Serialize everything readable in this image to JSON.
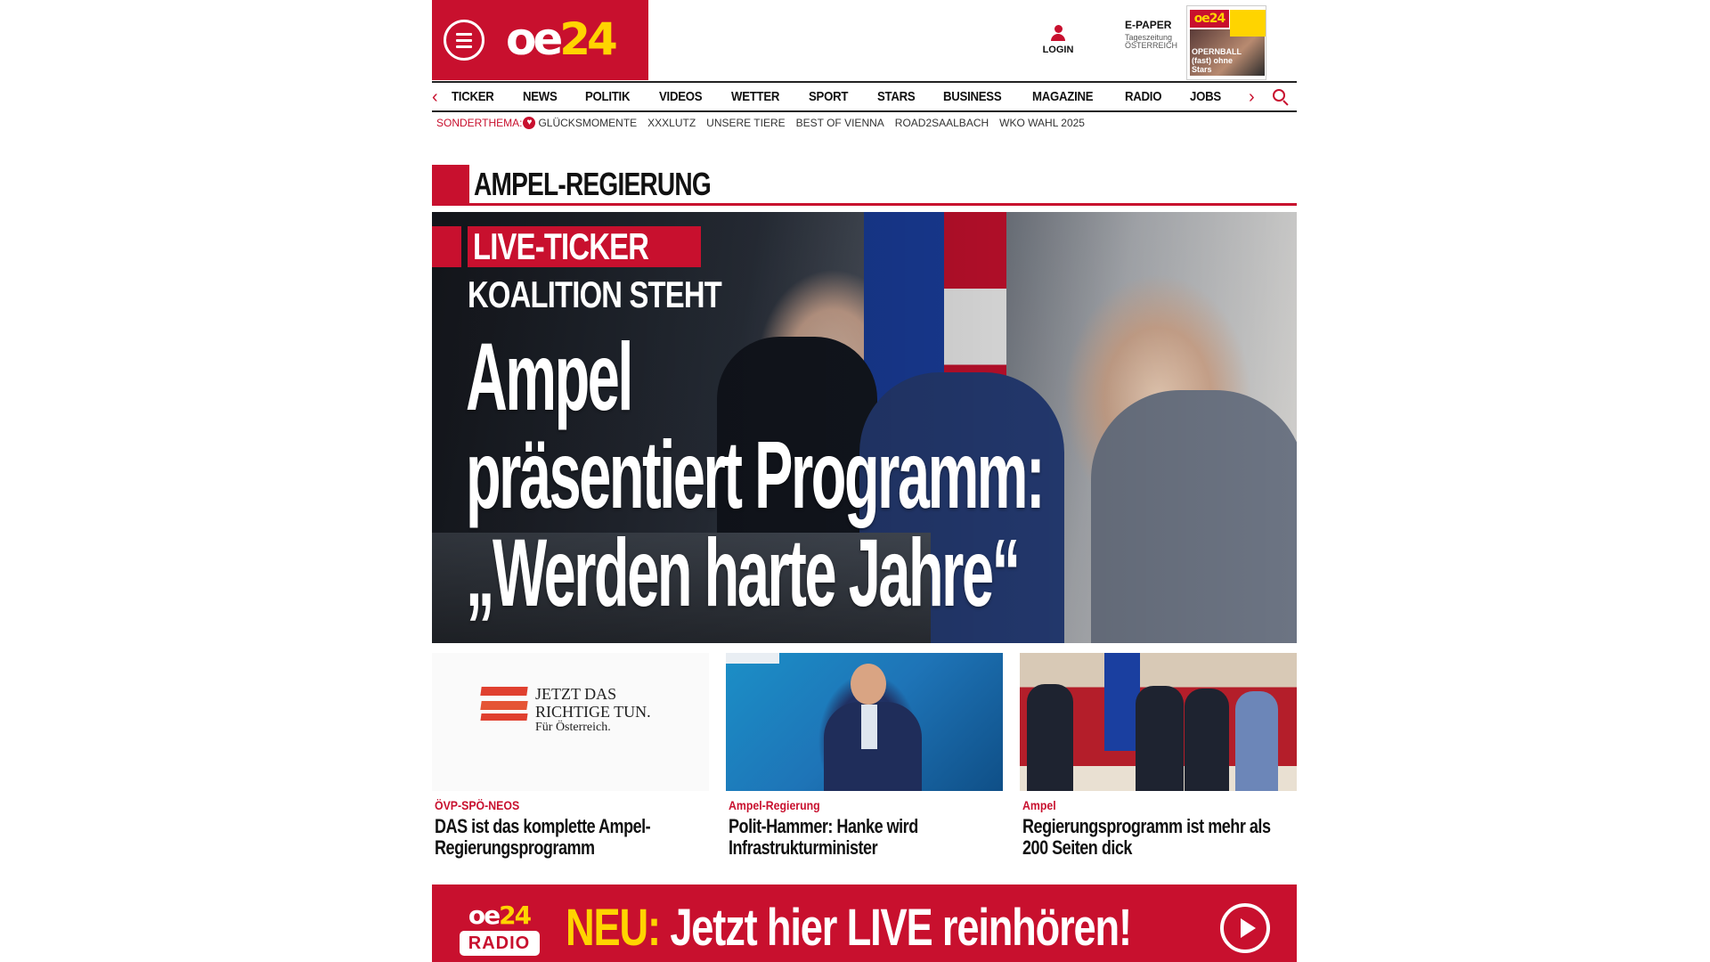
{
  "brand": {
    "logo_oe": "oe",
    "logo_num": "24",
    "accent": "#c8102e",
    "yellow": "#ffd400"
  },
  "header": {
    "menu_icon": "hamburger-menu-icon",
    "login_label": "LOGIN",
    "epaper": {
      "title": "E-PAPER",
      "subtitle_1": "Tageszeitung",
      "subtitle_2": "ÖSTERREICH",
      "cover_logo": "oe24",
      "cover_headline": "OPERNBALL (fast) ohne Stars"
    }
  },
  "nav": {
    "items": [
      "TICKER",
      "NEWS",
      "POLITIK",
      "VIDEOS",
      "WETTER",
      "SPORT",
      "STARS",
      "BUSINESS",
      "MAGAZINE",
      "RADIO",
      "JOBS"
    ],
    "left_arrow": "‹",
    "right_arrow": "›"
  },
  "special_topics": {
    "label": "SONDERTHEMA:",
    "items": [
      "GLÜCKSMOMENTE",
      "XXXLUTZ",
      "UNSERE TIERE",
      "BEST OF VIENNA",
      "ROAD2SAALBACH",
      "WKO WAHL 2025"
    ]
  },
  "section": {
    "title": "AMPEL-REGIERUNG"
  },
  "hero": {
    "badge": "LIVE-TICKER",
    "kicker": "KOALITION STEHT",
    "headline_line1": "Ampel",
    "headline_line2": "präsentiert Programm:",
    "headline_line3": "„Werden harte Jahre“"
  },
  "cards": [
    {
      "kicker": "ÖVP-SPÖ-NEOS",
      "title": "DAS ist das komplette Ampel-Regierungsprogramm",
      "image_text_1": "JETZT DAS",
      "image_text_2": "RICHTIGE TUN.",
      "image_text_3": "Für Österreich."
    },
    {
      "kicker": "Ampel-Regierung",
      "title": "Polit-Hammer: Hanke wird Infrastrukturminister"
    },
    {
      "kicker": "Ampel",
      "title": "Regierungsprogramm ist mehr als 200 Seiten dick"
    }
  ],
  "radio_banner": {
    "logo_top_oe": "oe",
    "logo_top_num": "24",
    "logo_bottom": "RADIO",
    "new_label": "NEU:",
    "text": "Jetzt hier LIVE reinhören!"
  }
}
